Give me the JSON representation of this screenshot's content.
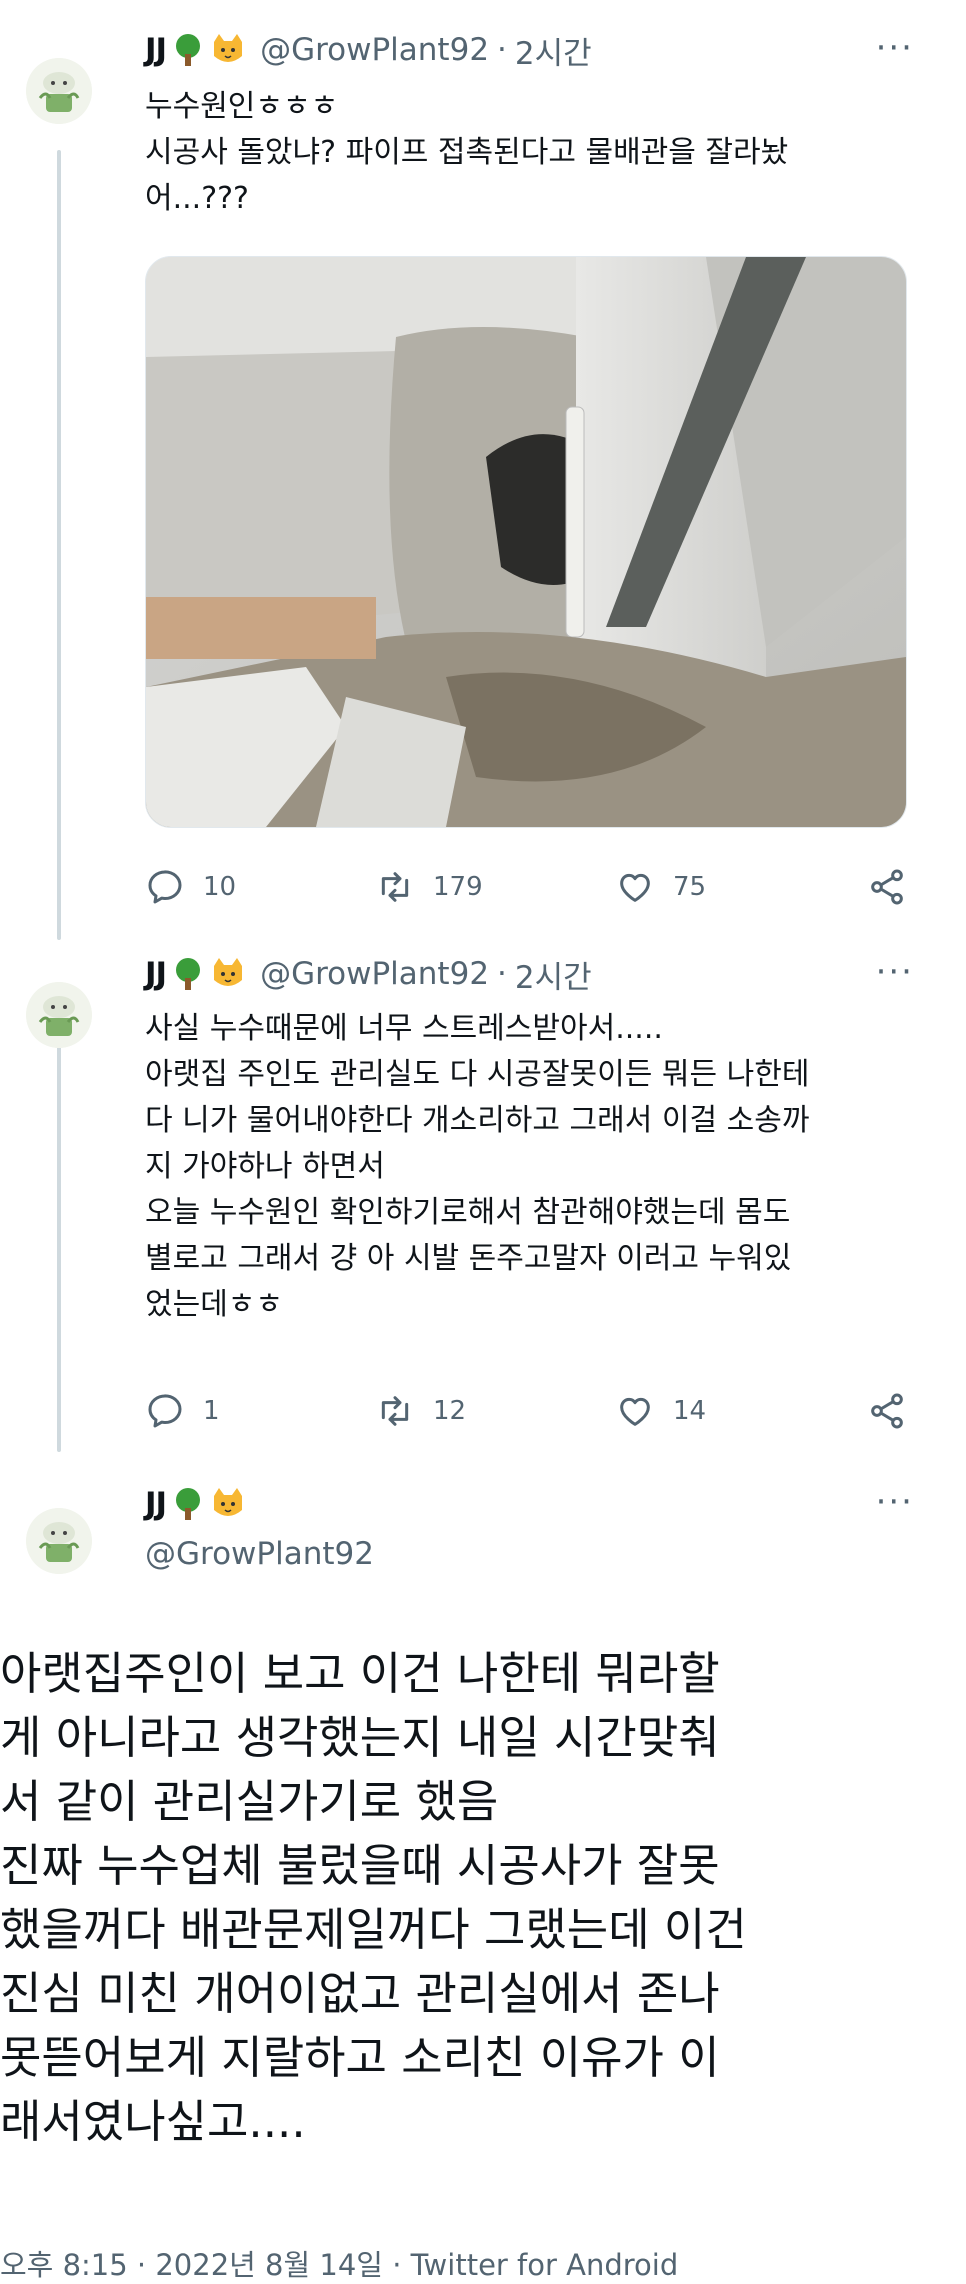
{
  "tweets": [
    {
      "name": "JJ",
      "handle": "@GrowPlant92",
      "time": "2시간",
      "text": "누수원인ㅎㅎㅎ\n시공사 돌았냐? 파이프 접촉된다고 물배관을 잘라놨\n어...???",
      "replies": "10",
      "retweets": "179",
      "likes": "75"
    },
    {
      "name": "JJ",
      "handle": "@GrowPlant92",
      "time": "2시간",
      "text": "사실 누수때문에 너무 스트레스받아서.....\n아랫집 주인도 관리실도 다 시공잘못이든 뭐든 나한테\n다 니가 물어내야한다 개소리하고 그래서 이걸 소송까\n지 가야하나 하면서\n오늘 누수원인 확인하기로해서 참관해야했는데 몸도\n별로고 그래서 걍 아 시발 돈주고말자 이러고 누워있\n었는데ㅎㅎ",
      "replies": "1",
      "retweets": "12",
      "likes": "14"
    }
  ],
  "main_tweet": {
    "name": "JJ",
    "handle": "@GrowPlant92",
    "text": "아랫집주인이 보고 이건 나한테 뭐라할\n게 아니라고 생각했는지 내일 시간맞춰\n서 같이 관리실가기로 했음\n진짜 누수업체 불렀을때 시공사가 잘못\n했을꺼다 배관문제일꺼다 그랬는데 이건\n진심 미친 개어이없고 관리실에서 존나\n못뜯어보게 지랄하고 소리친 이유가 이\n래서였나싶고....",
    "footer": "오후 8:15 · 2022년 8월 14일 · Twitter for Android"
  },
  "ui": {
    "separator": "·",
    "more": "···"
  },
  "icons": [
    "reply-icon",
    "retweet-icon",
    "like-icon",
    "share-icon",
    "tree-emoji-icon",
    "cat-emoji-icon"
  ],
  "colors": {
    "secondary_text": "#536471",
    "thread_line": "#cfd9de",
    "text": "#0f1419"
  }
}
